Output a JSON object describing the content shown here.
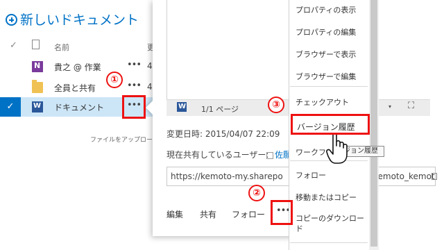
{
  "library": {
    "new_document": "新しいドキュメント",
    "column_name": "名前",
    "column_cut": "更",
    "upload_hint": "ファイルをアップロー",
    "rows": [
      {
        "label": "貴之 @ 作業",
        "more": "•••",
        "cut": "4"
      },
      {
        "label": "全員と共有",
        "more": "•••",
        "cut": "4"
      },
      {
        "label": "ドキュメント",
        "more": "•••",
        "cut": "4"
      }
    ]
  },
  "callout": {
    "preview_pages": "1/1 ページ",
    "modified": "変更日時: 2015/04/07 22:09",
    "shared_label": "現在共有しているユーザー:",
    "shared_name": "佐願",
    "url_left": "https://kemoto-my.sharepo",
    "url_right": "kemoto_kemot",
    "actions": {
      "edit": "編集",
      "share": "共有",
      "follow": "フォロー",
      "more": "•••"
    }
  },
  "menu": {
    "items": [
      "プロパティの表示",
      "プロパティの編集",
      "ブラウザーで表示",
      "ブラウザーで編集",
      "チェックアウト",
      "バージョン履歴",
      "ワークフ",
      "フォロー",
      "移動またはコピー",
      "コピーのダウンロード"
    ]
  },
  "tooltip": "ジョン履歴",
  "markers": [
    "①",
    "②",
    "③"
  ],
  "colors": {
    "accent": "#0072c6",
    "highlight": "#e11111",
    "selected_row": "#cde6f7"
  }
}
